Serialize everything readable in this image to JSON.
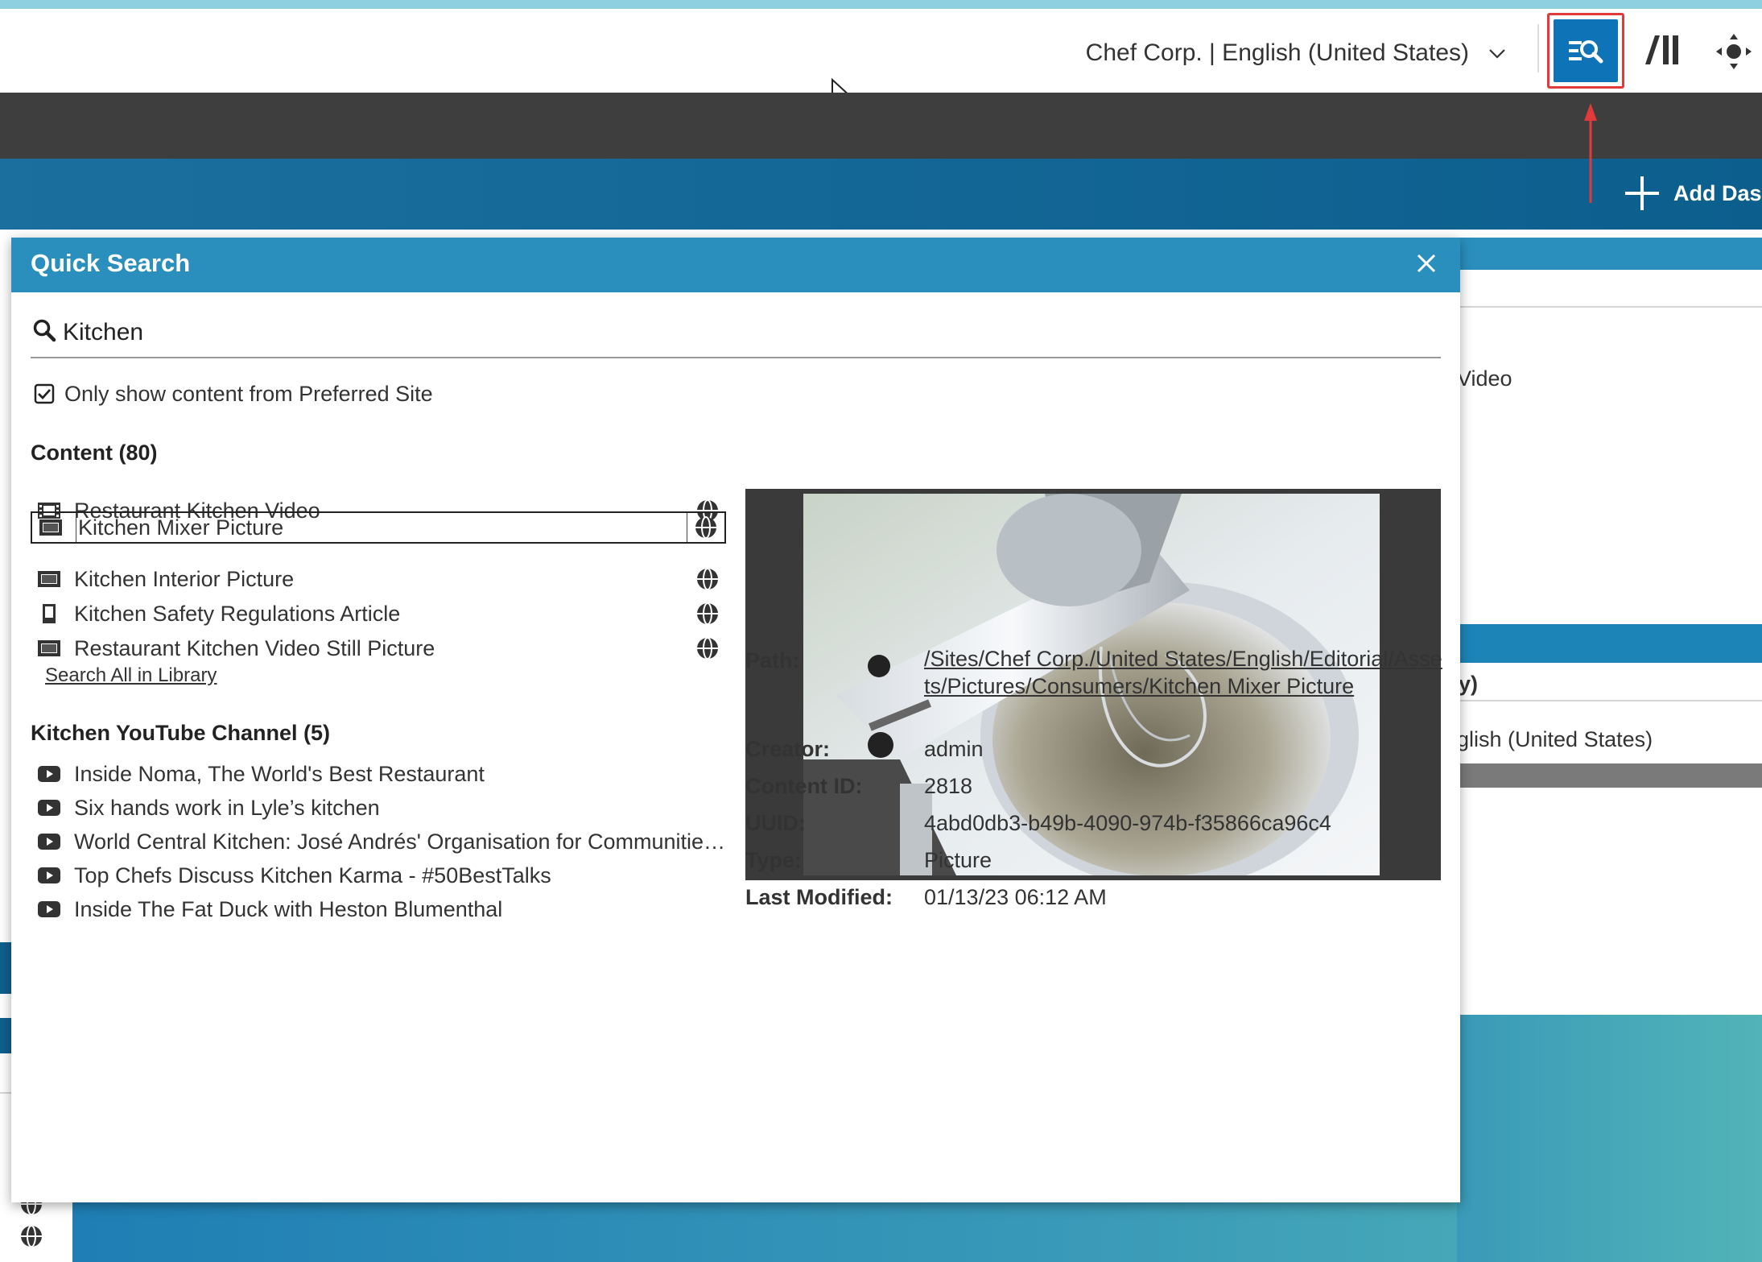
{
  "header": {
    "site_selector": "Chef Corp. | English (United States)",
    "add_dashboard": "Add Dash"
  },
  "background": {
    "video_text": "Video",
    "paren_text": "y)",
    "locale_text": "glish (United States)"
  },
  "colors": {
    "accent": "#0f73b8",
    "dialog_header": "#2a8fbd",
    "highlight": "#e03a3a",
    "dark_bar": "#3e3e3e"
  },
  "dialog": {
    "title": "Quick Search",
    "search_value": "Kitchen",
    "preferred_site_label": "Only show content from Preferred Site",
    "preferred_site_checked": true,
    "content_title": "Content (80)",
    "content_items": [
      {
        "label": "Restaurant Kitchen Video",
        "icon": "film-icon"
      },
      {
        "label": "Kitchen Mixer Picture",
        "icon": "picture-icon",
        "selected": true
      },
      {
        "label": "Kitchen Interior Picture",
        "icon": "picture-icon"
      },
      {
        "label": "Kitchen Safety Regulations Article",
        "icon": "article-icon"
      },
      {
        "label": "Restaurant Kitchen Video Still Picture",
        "icon": "picture-icon"
      }
    ],
    "search_all_link": "Search All in Library",
    "youtube_title": "Kitchen YouTube Channel (5)",
    "youtube_items": [
      "Inside Noma, The World's Best Restaurant",
      "Six hands work in Lyle’s kitchen",
      "World Central Kitchen: José Andrés' Organisation for Communities in Need",
      "Top Chefs Discuss Kitchen Karma - #50BestTalks",
      "Inside The Fat Duck with Heston Blumenthal"
    ],
    "details": {
      "path_label": "Path:",
      "path_value": "/Sites/Chef Corp./United States/English/Editorial/Assets/Pictures/Consumers/Kitchen Mixer Picture",
      "creator_label": "Creator:",
      "creator_value": "admin",
      "content_id_label": "Content ID:",
      "content_id_value": "2818",
      "uuid_label": "UUID:",
      "uuid_value": "4abd0db3-b49b-4090-974b-f35866ca96c4",
      "type_label": "Type:",
      "type_value": "Picture",
      "modified_label": "Last Modified:",
      "modified_value": "01/13/23 06:12 AM"
    }
  }
}
